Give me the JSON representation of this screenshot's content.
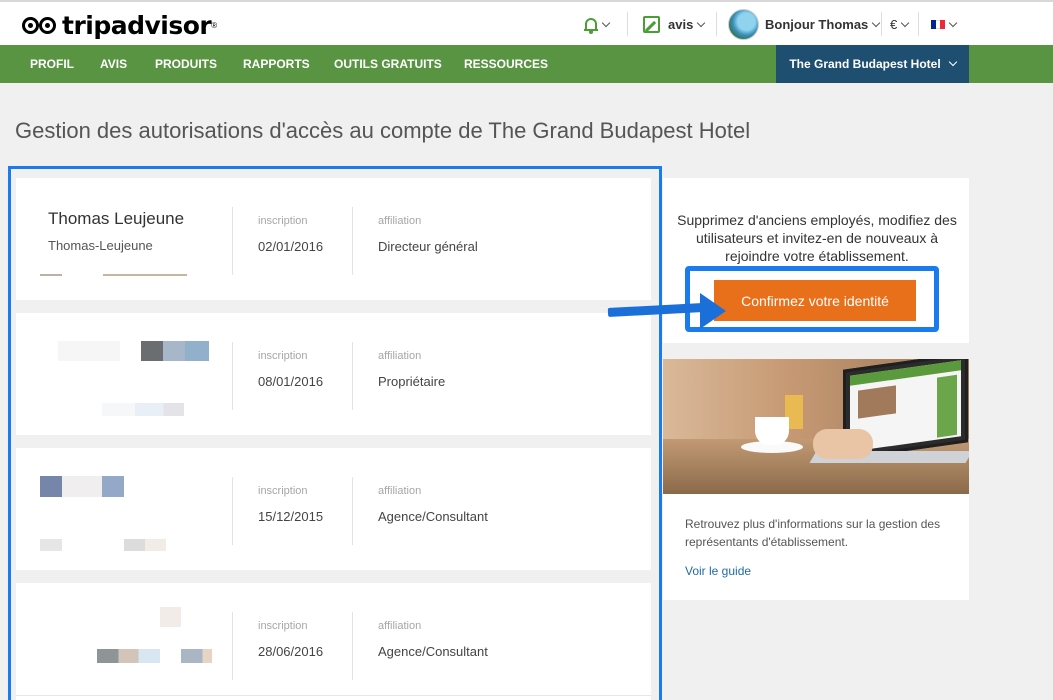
{
  "header": {
    "logo_text": "tripadvisor",
    "logo_reg": "®",
    "reviews_label": "avis",
    "greeting": "Bonjour Thomas",
    "currency": "€",
    "flag_colors": [
      "#002395",
      "#ffffff",
      "#ed2939"
    ]
  },
  "nav": {
    "items": [
      "PROFIL",
      "AVIS",
      "PRODUITS",
      "RAPPORTS",
      "OUTILS GRATUITS",
      "RESSOURCES"
    ],
    "hotel_selector": "The Grand Budapest Hotel"
  },
  "page_title": "Gestion des autorisations d'accès au compte de The Grand Budapest Hotel",
  "users": {
    "label_inscription": "inscription",
    "label_affiliation": "affiliation",
    "rows": [
      {
        "name": "Thomas Leujeune",
        "login": "Thomas-Leujeune",
        "inscription": "02/01/2016",
        "affiliation": "Directeur général"
      },
      {
        "name": "",
        "login": "",
        "inscription": "08/01/2016",
        "affiliation": "Propriétaire"
      },
      {
        "name": "",
        "login": "",
        "inscription": "15/12/2015",
        "affiliation": "Agence/Consultant"
      },
      {
        "name": "",
        "login": "",
        "inscription": "28/06/2016",
        "affiliation": "Agence/Consultant"
      }
    ]
  },
  "side": {
    "text": "Supprimez d'anciens employés, modifiez des utilisateurs et invitez-en de nouveaux à rejoindre votre établissement.",
    "cta": "Confirmez votre identité",
    "guide_text": "Retrouvez plus d'informations sur la gestion des représentants d'établissement.",
    "guide_link": "Voir le guide"
  },
  "colors": {
    "nav_green": "#589442",
    "hotel_blue": "#1e4f71",
    "cta_orange": "#e8701a",
    "highlight_blue": "#1a7bef",
    "link_blue": "#1e6ba8"
  }
}
